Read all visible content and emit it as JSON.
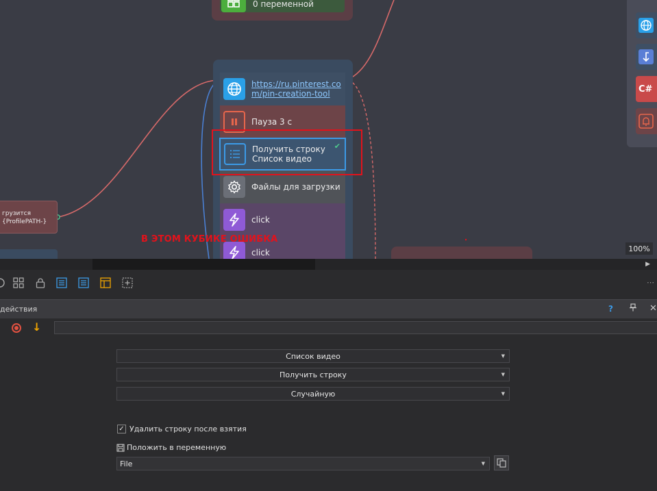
{
  "canvas": {
    "top_group": {
      "label": "0 переменной"
    },
    "nodes": [
      {
        "id": "url",
        "label": "https://ru.pinterest.com/pin-creation-tool",
        "line1": "https://ru.pinterest.co",
        "line2": "m/pin-creation-tool",
        "icon": "globe-icon"
      },
      {
        "id": "pause",
        "label": "Пауза 3 с",
        "icon": "pause-icon"
      },
      {
        "id": "list",
        "line1": "Получить строку",
        "line2": "Список видео",
        "icon": "list-icon",
        "status": "✔"
      },
      {
        "id": "files",
        "label": "Файлы для загрузки",
        "icon": "gear-icon"
      },
      {
        "id": "click1",
        "label": "click",
        "icon": "lightning-icon"
      },
      {
        "id": "click2",
        "label": "click",
        "icon": "lightning-icon"
      }
    ],
    "left_node": {
      "line1": "грузится",
      "line2": "{ProfilePATH-}"
    },
    "annotation": "В ЭТОМ КУБИКЕ ОШИБКА",
    "zoom": "100%",
    "right_panel": {
      "items": [
        "globe-icon",
        "arrow-down-left-icon",
        "csharp-icon",
        "bell-icon"
      ],
      "csharp_label": "C#"
    }
  },
  "toolbar": {
    "icons": [
      "eye-icon",
      "grid-icon",
      "lock-icon",
      "list-blue-icon",
      "list-blue-icon",
      "table-orange-icon",
      "add-box-icon"
    ]
  },
  "panel": {
    "title": "действия",
    "help": "?",
    "pin": "⭭",
    "close": "✕"
  },
  "form": {
    "source_list": "Список видео",
    "operation": "Получить строку",
    "mode": "Случайную",
    "delete_after": {
      "label": "Удалить строку после взятия",
      "checked": "✓"
    },
    "save_to_variable": {
      "label": "Положить в переменную"
    },
    "variable": "File"
  },
  "colors": {
    "canvas_bg": "#3a3c45",
    "highlight_box": "#e3121b",
    "selected_border": "#3c9be8",
    "link": "#8ec8ff"
  }
}
